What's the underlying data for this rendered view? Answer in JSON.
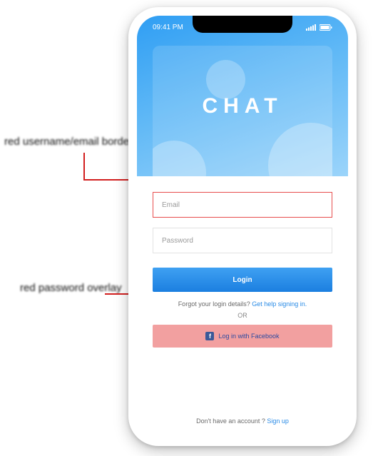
{
  "status": {
    "time": "09:41 PM"
  },
  "hero": {
    "title": "CHAT"
  },
  "form": {
    "email_placeholder": "Email",
    "password_placeholder": "Password",
    "login_label": "Login",
    "forgot_prefix": "Forgot your login details? ",
    "forgot_link": "Get help signing in.",
    "or_label": "OR",
    "fb_label": "Log in with Facebook"
  },
  "footer": {
    "signup_prefix": "Don't have an account ? ",
    "signup_link": "Sign up"
  },
  "annotations": {
    "callout1": "red username/email border",
    "callout2": "red password overlay"
  }
}
